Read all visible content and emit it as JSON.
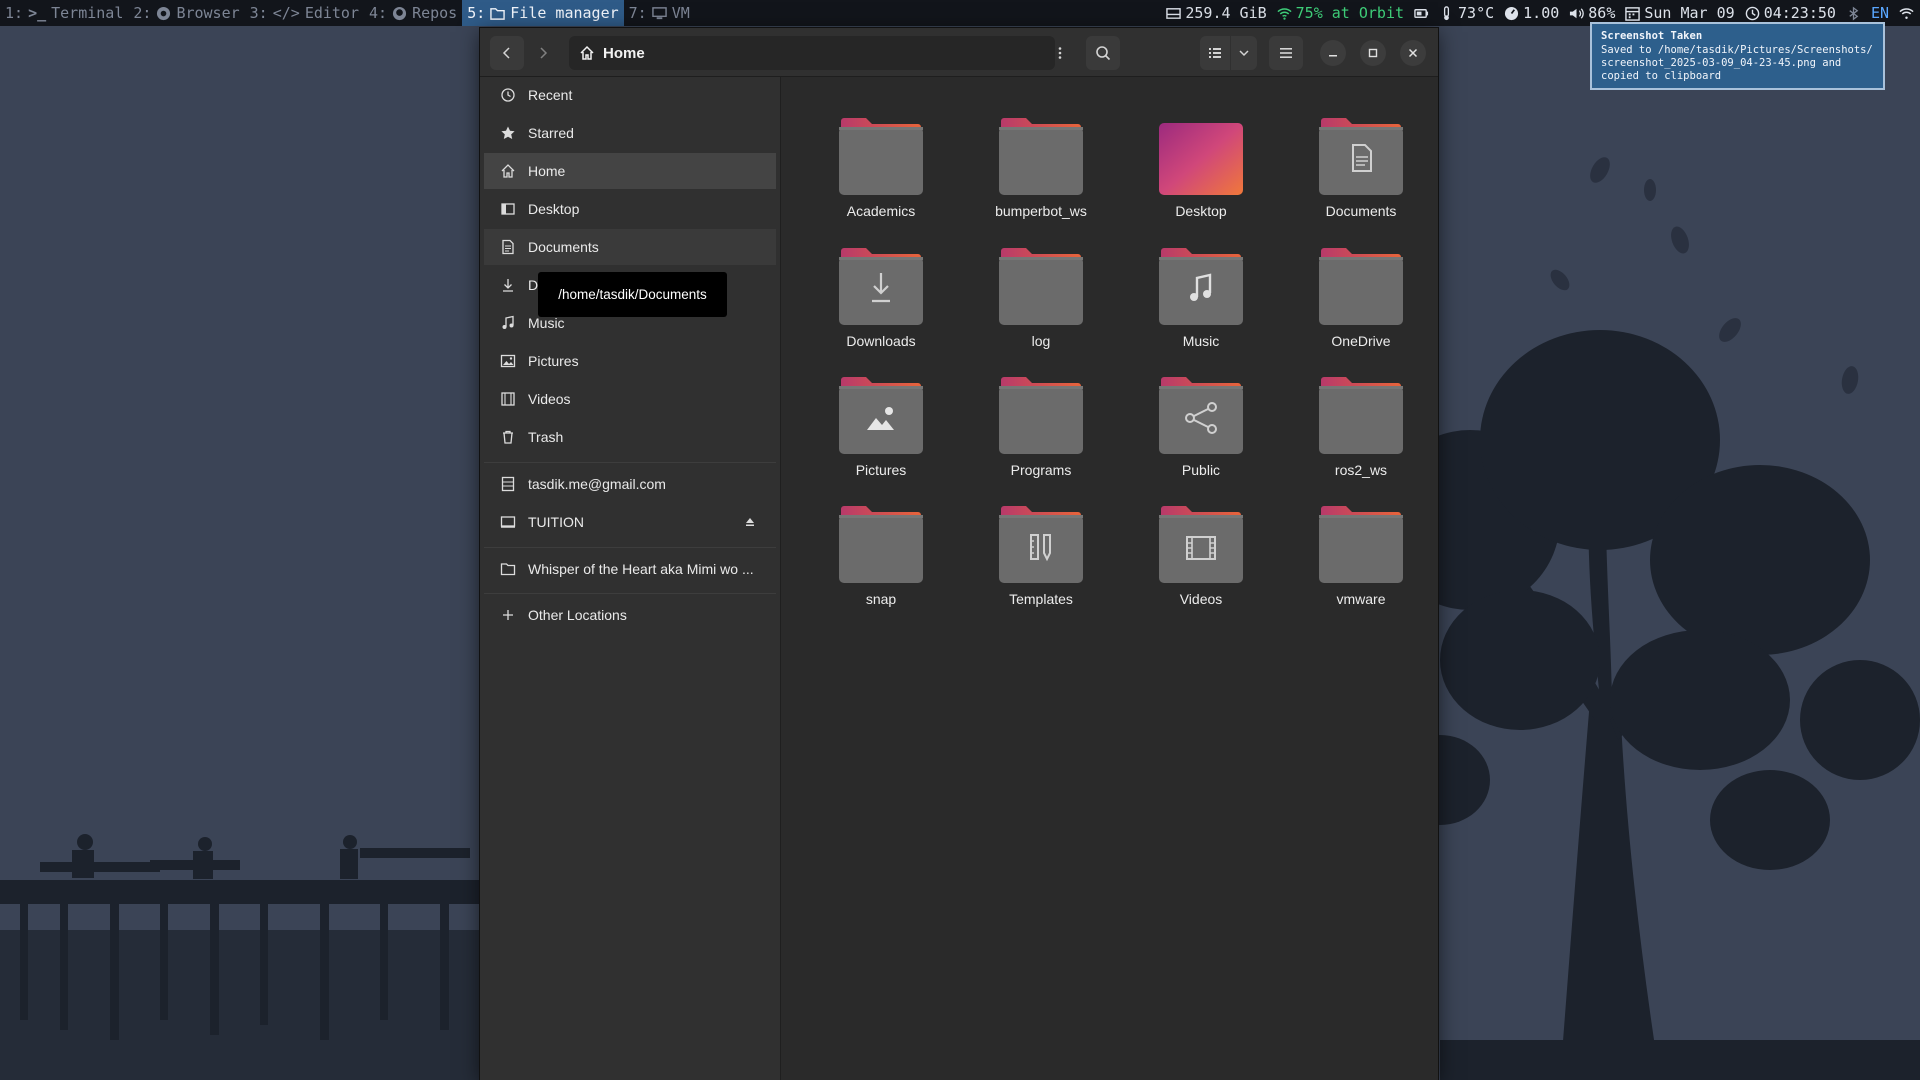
{
  "topbar": {
    "workspaces": [
      {
        "num": "1:",
        "label": "Terminal",
        "icon": "terminal-icon"
      },
      {
        "num": "2:",
        "label": "Browser",
        "icon": "browser-icon"
      },
      {
        "num": "3:",
        "label": "Editor",
        "icon": "code-icon"
      },
      {
        "num": "4:",
        "label": "Repos",
        "icon": "github-icon"
      },
      {
        "num": "5:",
        "label": "File manager",
        "icon": "folder-icon",
        "active": true
      },
      {
        "num": "7:",
        "label": "VM",
        "icon": "monitor-icon"
      }
    ],
    "status": {
      "disk": "259.4 GiB",
      "wifi": "75% at Orbit",
      "temp": "73°C",
      "load": "1.00",
      "volume": "86%",
      "date": "Sun Mar 09",
      "time": "04:23:50",
      "lang": "EN"
    }
  },
  "notification": {
    "title": "Screenshot Taken",
    "body": "Saved to /home/tasdik/Pictures/Screenshots/ screenshot_2025-03-09_04-23-45.png and copied to clipboard"
  },
  "window": {
    "path_title": "Home",
    "sidebar": [
      {
        "label": "Recent",
        "icon": "clock-icon"
      },
      {
        "label": "Starred",
        "icon": "star-icon"
      },
      {
        "label": "Home",
        "icon": "home-icon",
        "selected": true
      },
      {
        "label": "Desktop",
        "icon": "desktop-icon"
      },
      {
        "label": "Documents",
        "icon": "document-icon",
        "hover": true
      },
      {
        "label": "Do",
        "icon": "download-icon"
      },
      {
        "label": "Music",
        "icon": "music-icon"
      },
      {
        "label": "Pictures",
        "icon": "picture-icon"
      },
      {
        "label": "Videos",
        "icon": "video-icon"
      },
      {
        "label": "Trash",
        "icon": "trash-icon"
      },
      {
        "label": "tasdik.me@gmail.com",
        "icon": "cloud-drive-icon"
      },
      {
        "label": "TUITION",
        "icon": "drive-icon"
      },
      {
        "label": "Whisper of the Heart aka Mimi wo ...",
        "icon": "folder-outline-icon"
      },
      {
        "label": "Other Locations",
        "icon": "plus-icon"
      }
    ],
    "tooltip": "/home/tasdik/Documents",
    "files": [
      {
        "name": "Academics",
        "emblem": "none"
      },
      {
        "name": "bumperbot_ws",
        "emblem": "none"
      },
      {
        "name": "Desktop",
        "emblem": "desktop"
      },
      {
        "name": "Documents",
        "emblem": "document"
      },
      {
        "name": "Downloads",
        "emblem": "download"
      },
      {
        "name": "log",
        "emblem": "none"
      },
      {
        "name": "Music",
        "emblem": "music"
      },
      {
        "name": "OneDrive",
        "emblem": "none"
      },
      {
        "name": "Pictures",
        "emblem": "picture"
      },
      {
        "name": "Programs",
        "emblem": "none"
      },
      {
        "name": "Public",
        "emblem": "share"
      },
      {
        "name": "ros2_ws",
        "emblem": "none"
      },
      {
        "name": "snap",
        "emblem": "none"
      },
      {
        "name": "Templates",
        "emblem": "template"
      },
      {
        "name": "Videos",
        "emblem": "video"
      },
      {
        "name": "vmware",
        "emblem": "none"
      }
    ]
  },
  "colors": {
    "wallpaper": "#3b4456",
    "silhouette": "#1c222c",
    "accent_workspace": "#2f5b88",
    "folder_body": "#6b6b6b",
    "folder_tab_start": "#b83a6a",
    "folder_tab_end": "#e8643a"
  }
}
